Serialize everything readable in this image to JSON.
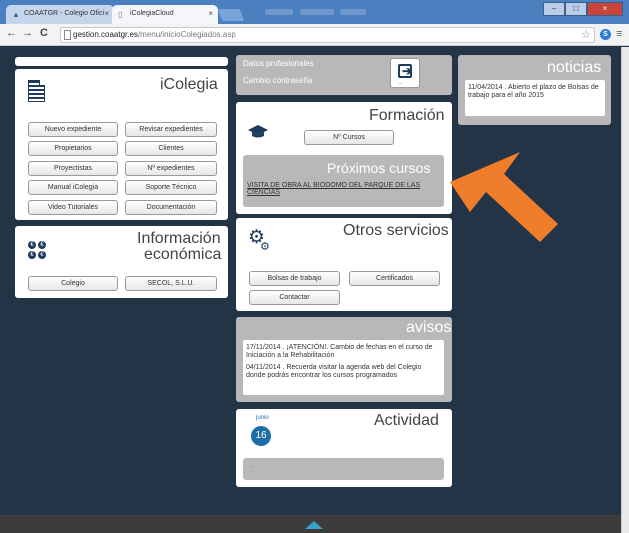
{
  "browser": {
    "tabs": [
      {
        "label": "COAATGR - Colegio Ofici",
        "close": "×"
      },
      {
        "label": "iColegiaCloud",
        "close": "×"
      }
    ],
    "window_buttons": [
      "–",
      "□",
      "×"
    ],
    "nav": {
      "back": "←",
      "forward": "→",
      "reload": "C"
    },
    "url_host": "gestion.coaatgr.es",
    "url_path": "/menu/inicioColegiados.asp",
    "star": "☆",
    "extension": "S",
    "menu": "≡"
  },
  "icolegia": {
    "title": "iColegia",
    "buttons": [
      "Nuevo expediente",
      "Revisar expedientes",
      "Propietarios",
      "Clientes",
      "Proyectistas",
      "Nº expedientes",
      "Manual iColegia",
      "Soporte Técnico",
      "Video Tutoriales",
      "Documentación"
    ]
  },
  "economica": {
    "title_line1": "Información",
    "title_line2": "económica",
    "buttons": [
      "Colegio",
      "SECOL, S.L.U."
    ]
  },
  "datos": {
    "link1": "Datos profesionales",
    "link2": "Cambio contraseña"
  },
  "formacion": {
    "title": "Formación",
    "button": "Nº Cursos",
    "proximos_title": "Próximos cursos",
    "curso_link": "VISITA DE OBRA AL BIODOMO DEL PARQUE DE LAS CIENCIAS"
  },
  "otros": {
    "title": "Otros servicios",
    "buttons": [
      "Bolsas de trabajo",
      "Certificados",
      "Contactar"
    ]
  },
  "avisos": {
    "title": "avisos",
    "items": [
      "17/11/2014 . ¡ATENCIÓN!. Cambio de fechas en el curso de Iniciación a la Rehabilitación",
      "04/11/2014 . Recuerda visitar la agenda web del Colegio donde podrás encontrar los cursos programados"
    ]
  },
  "actividad": {
    "title": "Actividad",
    "month": "junio",
    "day": "16",
    "bullet": "."
  },
  "noticias": {
    "title": "noticias",
    "text": "11/04/2014 . Abierto el plazo de Bolsas de trabajo para el año 2015"
  },
  "colors": {
    "background": "#243447",
    "panel_grey": "#b8b8b8",
    "arrow_orange": "#ef7d2b",
    "icon_navy": "#1d3b5c",
    "footer_accent": "#3aa0c8"
  }
}
